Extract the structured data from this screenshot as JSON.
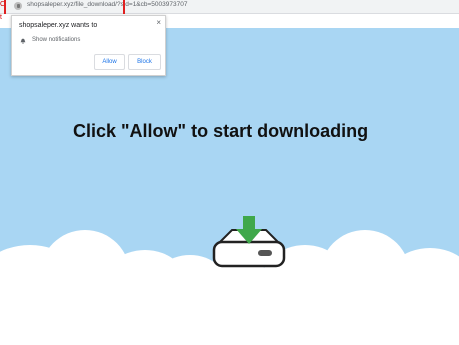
{
  "browser": {
    "address": "shopsaleper.xyz/file_download/?sid=1&cb=5003973707"
  },
  "popup": {
    "title": "shopsaleper.xyz wants to",
    "permission": "Show notifications",
    "allow_label": "Allow",
    "block_label": "Block",
    "close_glyph": "×"
  },
  "page": {
    "headline": "Click \"Allow\" to start downloading"
  },
  "icons": [
    "lock-icon",
    "bell-icon",
    "close-icon",
    "download-arrow-icon",
    "hard-drive-icon"
  ],
  "colors": {
    "sky": "#a9d6f3",
    "highlight_box": "#e02020",
    "button_text": "#1a73e8",
    "download_arrow": "#3fa84a"
  }
}
